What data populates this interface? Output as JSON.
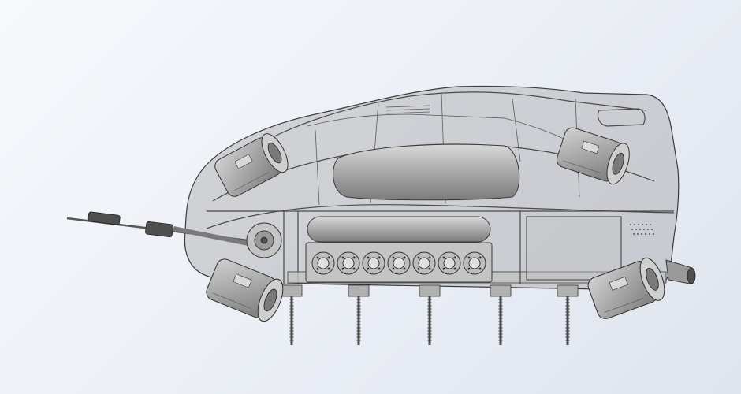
{
  "viewport": {
    "background_colors": [
      "#f6f8fb",
      "#dfe4ee"
    ],
    "model_color": "#9a9a9a",
    "edge_color": "#3a3a3a"
  },
  "model": {
    "icon": "cad-vehicle-model",
    "fans": 5,
    "flange_holes": 7,
    "support_legs": 5
  }
}
